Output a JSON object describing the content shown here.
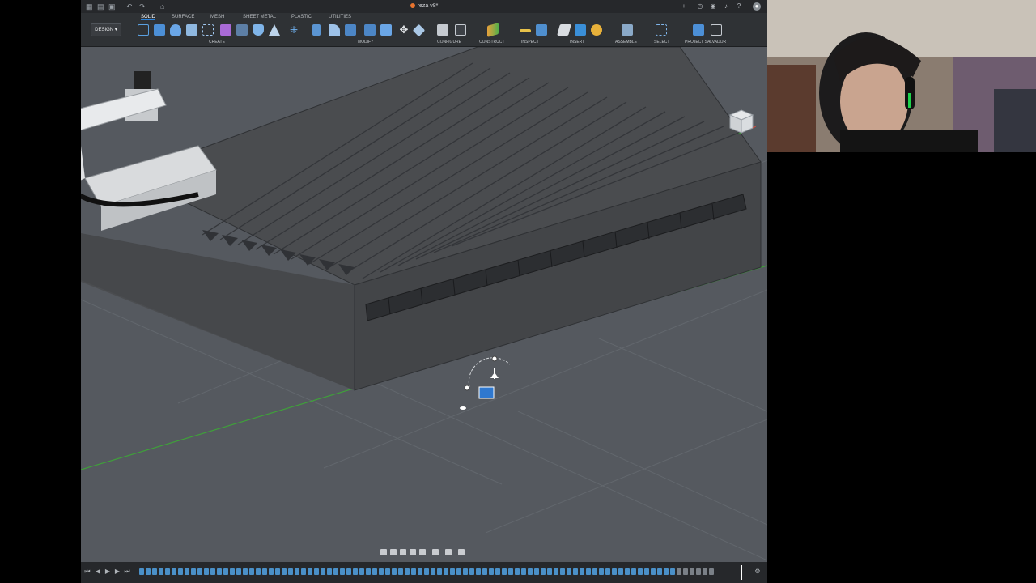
{
  "window": {
    "title": "reza v8*",
    "title_dot_color": "#e8742e"
  },
  "quick_access": {
    "icons": [
      "grid-icon",
      "file-icon",
      "save-icon",
      "undo-icon",
      "redo-icon",
      "home-icon"
    ]
  },
  "window_controls": {
    "icons": [
      "add-icon",
      "refresh-icon",
      "bell-icon",
      "help-icon",
      "account-icon"
    ]
  },
  "workspace": {
    "label": "DESIGN"
  },
  "tabs": [
    {
      "label": "SOLID",
      "active": true
    },
    {
      "label": "SURFACE"
    },
    {
      "label": "MESH"
    },
    {
      "label": "SHEET METAL"
    },
    {
      "label": "PLASTIC"
    },
    {
      "label": "UTILITIES"
    }
  ],
  "groups": {
    "create": "CREATE",
    "modify": "MODIFY",
    "configure": "CONFIGURE",
    "construct": "CONSTRUCT",
    "inspect": "INSPECT",
    "insert": "INSERT",
    "assemble": "ASSEMBLE",
    "select": "SELECT",
    "project_salvador": "PROJECT SALVADOR"
  },
  "accent": "#2a82da",
  "viewport_bg": "#55595f",
  "model_top": "#4a4c4f",
  "model_side": "#3d3f42",
  "axis_green": "#3fa03a"
}
